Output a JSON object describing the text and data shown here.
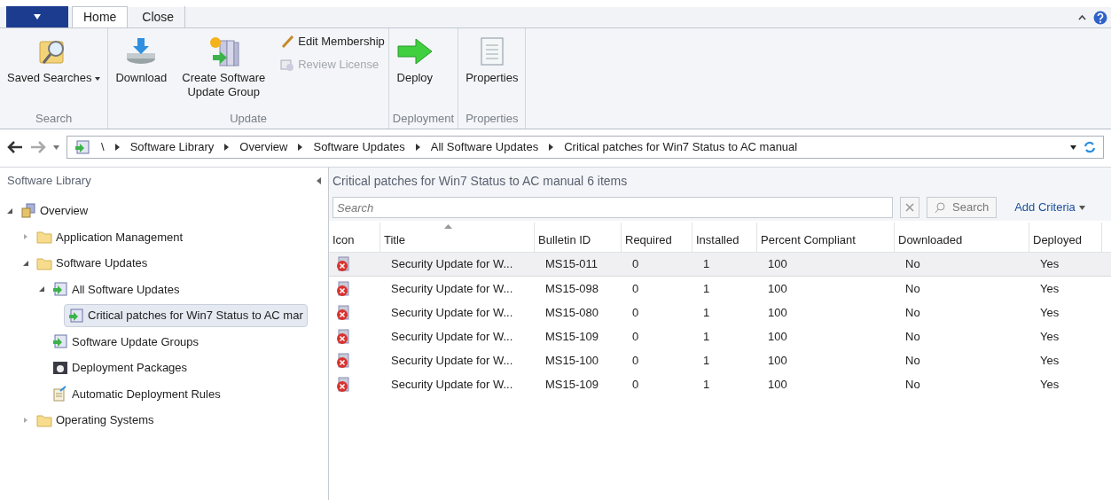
{
  "ribbon": {
    "tabs": [
      {
        "label": "Home",
        "selected": true
      },
      {
        "label": "Close",
        "selected": false
      }
    ],
    "groups": [
      {
        "label": "Search",
        "buttons": [
          {
            "kind": "saved",
            "label": "Saved Searches",
            "dropdown": true
          }
        ]
      },
      {
        "label": "Update",
        "buttons": [
          {
            "kind": "download",
            "label": "Download"
          },
          {
            "kind": "group",
            "label": "Create Software Update Group"
          }
        ],
        "small": [
          {
            "kind": "pencil",
            "label": "Edit Membership",
            "disabled": false
          },
          {
            "kind": "license",
            "label": "Review License",
            "disabled": true
          }
        ]
      },
      {
        "label": "Deployment",
        "buttons": [
          {
            "kind": "deploy",
            "label": "Deploy"
          }
        ]
      },
      {
        "label": "Properties",
        "buttons": [
          {
            "kind": "props",
            "label": "Properties"
          }
        ]
      }
    ]
  },
  "address": {
    "crumbs": [
      "\\",
      "Software Library",
      "Overview",
      "Software Updates",
      "All Software Updates",
      "Critical patches for Win7 Status to AC manual"
    ]
  },
  "sidebar": {
    "title": "Software Library",
    "items": [
      {
        "label": "Overview",
        "kind": "overview",
        "expanded": true,
        "children": [
          {
            "label": "Application Management",
            "kind": "folder",
            "expanded": false
          },
          {
            "label": "Software Updates",
            "kind": "folder",
            "expanded": true,
            "children": [
              {
                "label": "All Software Updates",
                "kind": "updates",
                "expanded": true,
                "children": [
                  {
                    "label": "Critical patches for Win7 Status to AC mar",
                    "kind": "updates",
                    "selected": true
                  }
                ]
              },
              {
                "label": "Software Update Groups",
                "kind": "updates",
                "selected": false
              },
              {
                "label": "Deployment Packages",
                "kind": "package",
                "selected": false
              },
              {
                "label": "Automatic Deployment Rules",
                "kind": "rules",
                "selected": false
              }
            ]
          },
          {
            "label": "Operating Systems",
            "kind": "folder",
            "expanded": false
          }
        ]
      }
    ]
  },
  "content": {
    "title": "Critical patches for Win7 Status to AC manual",
    "count": "6 items",
    "search": {
      "placeholder": "Search",
      "button": "Search"
    },
    "add_criteria": "Add Criteria",
    "table": {
      "columns": [
        "Icon",
        "Title",
        "Bulletin ID",
        "Required",
        "Installed",
        "Percent Compliant",
        "Downloaded",
        "Deployed"
      ],
      "rows": [
        {
          "selected": true,
          "cells": [
            "",
            "Security Update for W...",
            "MS15-011",
            "0",
            "1",
            "100",
            "No",
            "Yes"
          ]
        },
        {
          "selected": false,
          "cells": [
            "",
            "Security Update for W...",
            "MS15-098",
            "0",
            "1",
            "100",
            "No",
            "Yes"
          ]
        },
        {
          "selected": false,
          "cells": [
            "",
            "Security Update for W...",
            "MS15-080",
            "0",
            "1",
            "100",
            "No",
            "Yes"
          ]
        },
        {
          "selected": false,
          "cells": [
            "",
            "Security Update for W...",
            "MS15-109",
            "0",
            "1",
            "100",
            "No",
            "Yes"
          ]
        },
        {
          "selected": false,
          "cells": [
            "",
            "Security Update for W...",
            "MS15-100",
            "0",
            "1",
            "100",
            "No",
            "Yes"
          ]
        },
        {
          "selected": false,
          "cells": [
            "",
            "Security Update for W...",
            "MS15-109",
            "0",
            "1",
            "100",
            "No",
            "Yes"
          ]
        }
      ]
    }
  }
}
